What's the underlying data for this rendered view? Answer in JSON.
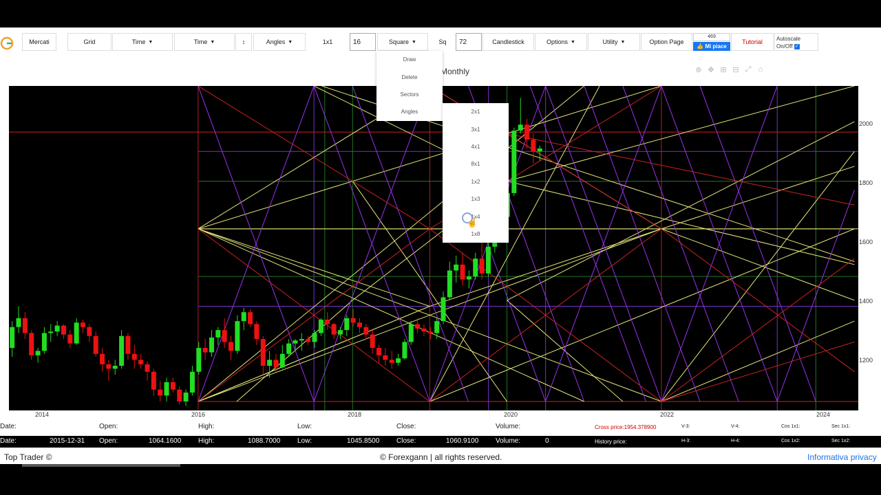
{
  "toolbar": {
    "mercati": "Mercati",
    "grid": "Grid",
    "time1": "Time",
    "time2": "Time",
    "swap": "↕",
    "angles": "Angles",
    "ratio_label": "1x1",
    "ratio_value": "16",
    "square": "Square",
    "sq_label": "Sq",
    "sq_value": "72",
    "candlestick": "Candlestick",
    "options": "Options",
    "utility": "Utility",
    "option_page": "Option Page",
    "tutorial": "Tutorial",
    "fb_count": "469",
    "fb_like": "Mi piace",
    "autoscale_line1": "Autoscale",
    "autoscale_line2": "On/Off"
  },
  "colors": {
    "tutorial": "#cc0000",
    "bull": "#22dd22",
    "bear": "#ee1111",
    "fb": "#1877f2"
  },
  "chart": {
    "title": "Monthly",
    "y_ticks": [
      "2000",
      "1800",
      "1600",
      "1400",
      "1200"
    ],
    "x_ticks": [
      "2014",
      "2016",
      "2018",
      "2020",
      "2022",
      "2024"
    ]
  },
  "square_menu": [
    "Draw",
    "Delete",
    "Sectors",
    "Angles"
  ],
  "angles_submenu": [
    "2x1",
    "3x1",
    "4x1",
    "8x1",
    "1x2",
    "1x3",
    "1x4",
    "1x8"
  ],
  "info1": {
    "date_label": "Date:",
    "open_label": "Open:",
    "high_label": "High:",
    "low_label": "Low:",
    "close_label": "Close:",
    "volume_label": "Volume:",
    "cross_price": "Cross price:1954.378900",
    "v3": "V-3:",
    "v4": "V-4:",
    "cos11": "Cos 1x1:",
    "sec11": "Sec 1x1:"
  },
  "info2": {
    "date_label": "Date:",
    "date": "2015-12-31",
    "open_label": "Open:",
    "open": "1064.1600",
    "high_label": "High:",
    "high": "1088.7000",
    "low_label": "Low:",
    "low": "1045.8500",
    "close_label": "Close:",
    "close": "1060.9100",
    "volume_label": "Volume:",
    "volume": "0",
    "history_label": "History price:",
    "h3": "H-3:",
    "h4": "H-4:",
    "cos12": "Cos 1x2:",
    "sec12": "Sec 1x2:"
  },
  "footer": {
    "left": "Top Trader ©",
    "center": "© Forexgann | all rights reserved.",
    "right": "Informativa privacy"
  },
  "chart_data": {
    "type": "candlestick",
    "title": "Monthly",
    "x_ticks": [
      "2014",
      "2016",
      "2018",
      "2020",
      "2022",
      "2024"
    ],
    "y_ticks": [
      2000,
      1800,
      1600,
      1400,
      1200
    ],
    "ylim": [
      1030,
      2120
    ],
    "xlim": [
      2013.55,
      2024.55
    ],
    "grid": true,
    "candles": [
      [
        1240,
        1330,
        1210,
        1310
      ],
      [
        1310,
        1380,
        1290,
        1340
      ],
      [
        1340,
        1360,
        1270,
        1290
      ],
      [
        1290,
        1300,
        1200,
        1215
      ],
      [
        1215,
        1240,
        1190,
        1230
      ],
      [
        1230,
        1310,
        1220,
        1290
      ],
      [
        1290,
        1320,
        1260,
        1295
      ],
      [
        1295,
        1330,
        1280,
        1315
      ],
      [
        1315,
        1320,
        1270,
        1285
      ],
      [
        1285,
        1300,
        1240,
        1255
      ],
      [
        1255,
        1340,
        1250,
        1325
      ],
      [
        1325,
        1335,
        1290,
        1310
      ],
      [
        1310,
        1320,
        1260,
        1280
      ],
      [
        1280,
        1295,
        1210,
        1220
      ],
      [
        1220,
        1240,
        1160,
        1185
      ],
      [
        1185,
        1200,
        1130,
        1170
      ],
      [
        1170,
        1200,
        1150,
        1180
      ],
      [
        1180,
        1300,
        1170,
        1280
      ],
      [
        1280,
        1290,
        1200,
        1220
      ],
      [
        1220,
        1250,
        1170,
        1200
      ],
      [
        1200,
        1220,
        1170,
        1185
      ],
      [
        1185,
        1195,
        1130,
        1160
      ],
      [
        1160,
        1170,
        1080,
        1100
      ],
      [
        1100,
        1130,
        1060,
        1080
      ],
      [
        1080,
        1140,
        1060,
        1125
      ],
      [
        1125,
        1140,
        1090,
        1100
      ],
      [
        1100,
        1110,
        1050,
        1060
      ],
      [
        1060,
        1100,
        1045,
        1090
      ],
      [
        1090,
        1180,
        1080,
        1160
      ],
      [
        1160,
        1260,
        1150,
        1240
      ],
      [
        1240,
        1270,
        1200,
        1225
      ],
      [
        1225,
        1300,
        1210,
        1275
      ],
      [
        1275,
        1310,
        1250,
        1300
      ],
      [
        1300,
        1340,
        1240,
        1260
      ],
      [
        1260,
        1280,
        1200,
        1230
      ],
      [
        1230,
        1350,
        1220,
        1330
      ],
      [
        1330,
        1375,
        1300,
        1360
      ],
      [
        1360,
        1370,
        1310,
        1320
      ],
      [
        1320,
        1330,
        1250,
        1270
      ],
      [
        1270,
        1280,
        1150,
        1180
      ],
      [
        1180,
        1230,
        1140,
        1200
      ],
      [
        1200,
        1220,
        1160,
        1175
      ],
      [
        1175,
        1250,
        1170,
        1220
      ],
      [
        1220,
        1270,
        1210,
        1255
      ],
      [
        1255,
        1270,
        1230,
        1265
      ],
      [
        1265,
        1290,
        1230,
        1270
      ],
      [
        1270,
        1280,
        1250,
        1260
      ],
      [
        1260,
        1300,
        1240,
        1290
      ],
      [
        1290,
        1340,
        1280,
        1335
      ],
      [
        1335,
        1360,
        1300,
        1320
      ],
      [
        1320,
        1325,
        1270,
        1285
      ],
      [
        1285,
        1310,
        1270,
        1300
      ],
      [
        1300,
        1350,
        1280,
        1340
      ],
      [
        1340,
        1370,
        1310,
        1325
      ],
      [
        1325,
        1340,
        1290,
        1310
      ],
      [
        1310,
        1320,
        1270,
        1285
      ],
      [
        1285,
        1300,
        1220,
        1240
      ],
      [
        1240,
        1250,
        1190,
        1215
      ],
      [
        1215,
        1240,
        1180,
        1200
      ],
      [
        1200,
        1230,
        1170,
        1190
      ],
      [
        1190,
        1220,
        1180,
        1205
      ],
      [
        1205,
        1270,
        1200,
        1260
      ],
      [
        1260,
        1330,
        1250,
        1320
      ],
      [
        1320,
        1340,
        1290,
        1305
      ],
      [
        1305,
        1320,
        1280,
        1295
      ],
      [
        1295,
        1310,
        1270,
        1290
      ],
      [
        1290,
        1340,
        1270,
        1330
      ],
      [
        1330,
        1430,
        1320,
        1410
      ],
      [
        1410,
        1530,
        1400,
        1500
      ],
      [
        1500,
        1550,
        1460,
        1520
      ],
      [
        1520,
        1560,
        1450,
        1470
      ],
      [
        1470,
        1500,
        1440,
        1480
      ],
      [
        1480,
        1560,
        1470,
        1540
      ],
      [
        1540,
        1620,
        1470,
        1490
      ],
      [
        1490,
        1610,
        1480,
        1580
      ],
      [
        1580,
        1690,
        1560,
        1640
      ],
      [
        1640,
        1700,
        1620,
        1680
      ],
      [
        1680,
        1780,
        1660,
        1760
      ],
      [
        1760,
        1980,
        1750,
        1970
      ],
      [
        1970,
        2080,
        1960,
        1990
      ],
      [
        1990,
        2010,
        1910,
        1940
      ],
      [
        1940,
        1960,
        1860,
        1900
      ],
      [
        1900,
        1920,
        1870,
        1910
      ]
    ],
    "gann_lines": [
      {
        "color": "#e6e67a",
        "segments": [
          [
            2016,
            1060,
            2019,
            1380
          ],
          [
            2016,
            1060,
            2022,
            1640
          ],
          [
            2016,
            1060,
            2021,
            2120
          ],
          [
            2019,
            1060,
            2024.5,
            1640
          ],
          [
            2019,
            1060,
            2021.2,
            2120
          ],
          [
            2022,
            1060,
            2024.5,
            1330
          ],
          [
            2022,
            1060,
            2024.5,
            1900
          ],
          [
            2016,
            1640,
            2019,
            1380
          ],
          [
            2016,
            1640,
            2022,
            1060
          ],
          [
            2016,
            1640,
            2019,
            2120
          ],
          [
            2016,
            1640,
            2021,
            1060
          ],
          [
            2019,
            2120,
            2022,
            1640
          ],
          [
            2019,
            1380,
            2022,
            1640
          ],
          [
            2022,
            1640,
            2024.5,
            1850
          ],
          [
            2022,
            1640,
            2024.5,
            1400
          ],
          [
            2019,
            1380,
            2016,
            1060
          ],
          [
            2018,
            1800,
            2020,
            1060
          ],
          [
            2018,
            1800,
            2016,
            1640
          ],
          [
            2018,
            1800,
            2022,
            2120
          ],
          [
            2020,
            1800,
            2024.5,
            1520
          ],
          [
            2020,
            1800,
            2017.5,
            2120
          ],
          [
            2020,
            1800,
            2024.5,
            2120
          ],
          [
            2020,
            1400,
            2024.5,
            2000
          ],
          [
            2018,
            1400,
            2020,
            1800
          ],
          [
            2018,
            1400,
            2016.5,
            1060
          ],
          [
            2020,
            1400,
            2021.5,
            1060
          ],
          [
            2017.6,
            2120,
            2024.5,
            1530
          ],
          [
            2016,
            1640,
            2024.5,
            1640
          ]
        ]
      },
      {
        "color": "#9933ee",
        "segments": [
          [
            2016,
            2120,
            2017.5,
            1060
          ],
          [
            2017.5,
            1060,
            2019,
            2120
          ],
          [
            2019,
            2120,
            2020.5,
            1060
          ],
          [
            2020.5,
            1060,
            2022,
            2120
          ],
          [
            2022,
            2120,
            2023.5,
            1060
          ],
          [
            2023.5,
            1060,
            2024.5,
            1770
          ],
          [
            2016,
            1060,
            2017.5,
            2120
          ],
          [
            2017.5,
            2120,
            2019,
            1060
          ],
          [
            2019,
            1060,
            2020.5,
            2120
          ],
          [
            2020.5,
            2120,
            2022,
            1060
          ],
          [
            2022,
            1060,
            2023.5,
            2120
          ],
          [
            2018,
            2120,
            2019.5,
            1060
          ],
          [
            2019.5,
            2120,
            2021,
            1060
          ],
          [
            2021,
            2120,
            2022.5,
            1060
          ],
          [
            2022.5,
            2120,
            2024,
            1060
          ],
          [
            2020.3,
            2120,
            2021.8,
            1060
          ],
          [
            2021.5,
            2120,
            2023,
            1060
          ]
        ]
      },
      {
        "color": "#cc2222",
        "segments": [
          [
            2016,
            1060,
            2019,
            1640
          ],
          [
            2019,
            1640,
            2022,
            1060
          ],
          [
            2022,
            1060,
            2024.5,
            1540
          ],
          [
            2016,
            1640,
            2019,
            1060
          ],
          [
            2019,
            1060,
            2022,
            1640
          ],
          [
            2022,
            1640,
            2024.5,
            1160
          ],
          [
            2019,
            1640,
            2022,
            2120
          ],
          [
            2019,
            2120,
            2022,
            1640
          ],
          [
            2019,
            1640,
            2016,
            2120
          ],
          [
            2020,
            1960,
            2024.5,
            1720
          ],
          [
            2022,
            1060,
            2024.5,
            1260
          ]
        ]
      }
    ],
    "v_lines": [
      {
        "x": 2016,
        "color": "#aa2222"
      },
      {
        "x": 2017.64,
        "color": "#227722"
      },
      {
        "x": 2018,
        "color": "#227722"
      },
      {
        "x": 2019,
        "color": "#aa2222"
      },
      {
        "x": 2020,
        "color": "#227722"
      },
      {
        "x": 2020.5,
        "color": "#7733cc"
      },
      {
        "x": 2022,
        "color": "#aa2222"
      },
      {
        "x": 2024,
        "color": "#227722"
      },
      {
        "x": 2017.5,
        "color": "#7733cc"
      },
      {
        "x": 2023.5,
        "color": "#7733cc"
      },
      {
        "x": 2019.76,
        "color": "#7733cc"
      }
    ],
    "h_lines": [
      {
        "y": 1965,
        "color": "#cc2222",
        "from": 2013.55
      },
      {
        "y": 1900,
        "color": "#7733cc",
        "from": 2016
      },
      {
        "y": 1640,
        "color": "#e6e67a",
        "from": 2016
      },
      {
        "y": 1380,
        "color": "#7733cc",
        "from": 2016
      },
      {
        "y": 1060,
        "color": "#cc2222",
        "from": 2016
      },
      {
        "y": 1800,
        "color": "#227722",
        "from": 2016
      },
      {
        "y": 1480,
        "color": "#227722",
        "from": 2016
      }
    ]
  }
}
